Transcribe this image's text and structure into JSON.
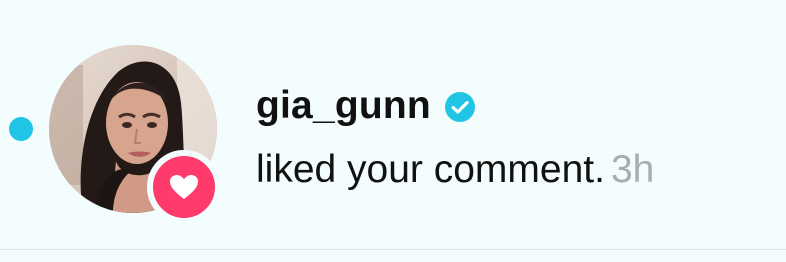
{
  "notification": {
    "username": "gia_gunn",
    "message": "liked your comment.",
    "time": "3h",
    "verified": true,
    "unread": true
  },
  "icons": {
    "unread_indicator": "unread-dot-icon",
    "verified": "verified-check-icon",
    "reaction": "heart-icon"
  },
  "colors": {
    "background": "#f3fdfd",
    "unread_dot": "#20c5e6",
    "verified_badge": "#20c5e6",
    "heart_badge": "#ff3b6b",
    "text_primary": "#111111",
    "text_secondary": "#a8adae"
  }
}
